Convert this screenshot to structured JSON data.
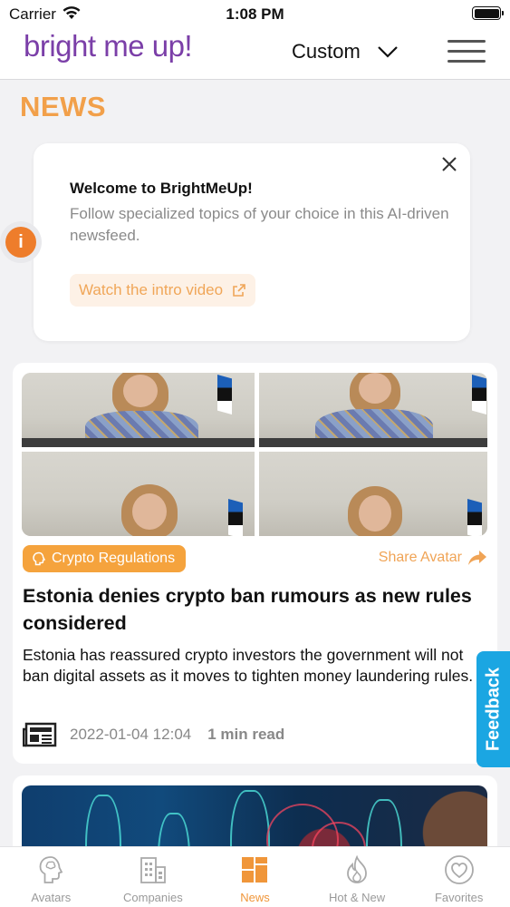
{
  "status_bar": {
    "carrier": "Carrier",
    "time": "1:08 PM"
  },
  "header": {
    "logo": "bright me up!",
    "filter_label": "Custom"
  },
  "section": {
    "title": "NEWS"
  },
  "welcome": {
    "info_icon_glyph": "i",
    "title": "Welcome to BrightMeUp!",
    "body": "Follow specialized topics of your choice in this AI-driven newsfeed.",
    "button_label": "Watch the intro video"
  },
  "article": {
    "tag": "Crypto Regulations",
    "share_label": "Share Avatar",
    "headline": "Estonia denies crypto ban rumours as new rules considered",
    "summary": "Estonia has reassured crypto investors the government will not ban digital assets as it moves to tighten money laundering rules.",
    "date": "2022-01-04 12:04",
    "read_time": "1 min read"
  },
  "feedback": {
    "label": "Feedback"
  },
  "tabbar": {
    "items": [
      {
        "label": "Avatars",
        "icon": "head-icon",
        "active": false
      },
      {
        "label": "Companies",
        "icon": "building-icon",
        "active": false
      },
      {
        "label": "News",
        "icon": "grid-icon",
        "active": true
      },
      {
        "label": "Hot & New",
        "icon": "flame-icon",
        "active": false
      },
      {
        "label": "Favorites",
        "icon": "heart-icon",
        "active": false
      }
    ]
  },
  "colors": {
    "accent": "#f0963a",
    "brand": "#7b3fa8",
    "feedback": "#1ba6e2",
    "tag": "#f5a33d"
  }
}
